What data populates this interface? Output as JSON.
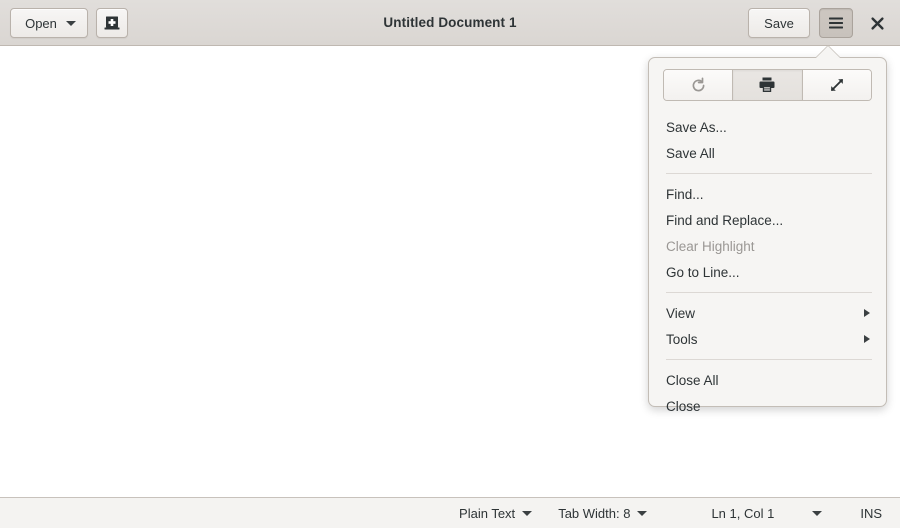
{
  "window": {
    "title": "Untitled Document 1"
  },
  "header": {
    "open_label": "Open",
    "open_icon": "chevron-down-icon",
    "new_document_icon": "new-document-icon",
    "save_label": "Save",
    "menu_icon": "hamburger-menu-icon",
    "close_icon": "window-close-icon"
  },
  "document": {
    "content": ""
  },
  "menu": {
    "toolbar": [
      {
        "name": "revert-button",
        "icon": "reload-icon",
        "disabled": true,
        "pressed": false
      },
      {
        "name": "print-button",
        "icon": "printer-icon",
        "disabled": false,
        "pressed": true
      },
      {
        "name": "fullscreen-button",
        "icon": "fullscreen-icon",
        "disabled": false,
        "pressed": false
      }
    ],
    "groups": [
      {
        "items": [
          {
            "label": "Save As...",
            "disabled": false,
            "submenu": false
          },
          {
            "label": "Save All",
            "disabled": false,
            "submenu": false
          }
        ]
      },
      {
        "items": [
          {
            "label": "Find...",
            "disabled": false,
            "submenu": false
          },
          {
            "label": "Find and Replace...",
            "disabled": false,
            "submenu": false
          },
          {
            "label": "Clear Highlight",
            "disabled": true,
            "submenu": false
          },
          {
            "label": "Go to Line...",
            "disabled": false,
            "submenu": false
          }
        ]
      },
      {
        "items": [
          {
            "label": "View",
            "disabled": false,
            "submenu": true
          },
          {
            "label": "Tools",
            "disabled": false,
            "submenu": true
          }
        ]
      },
      {
        "items": [
          {
            "label": "Close All",
            "disabled": false,
            "submenu": false
          },
          {
            "label": "Close",
            "disabled": false,
            "submenu": false
          }
        ]
      }
    ]
  },
  "statusbar": {
    "language": "Plain Text",
    "tab_width": "Tab Width: 8",
    "cursor_position": "Ln 1, Col 1",
    "insert_mode": "INS"
  },
  "colors": {
    "headerbar_top": "#e1dedb",
    "headerbar_bottom": "#dad6d2",
    "headerbar_border": "#bfb8b1",
    "text": "#2e3436",
    "disabled_text": "#9a9794",
    "popover_bg": "#f6f5f3",
    "popover_border": "#c3bdb6",
    "statusbar_bg": "#f4f3f1",
    "document_bg": "#ffffff"
  }
}
